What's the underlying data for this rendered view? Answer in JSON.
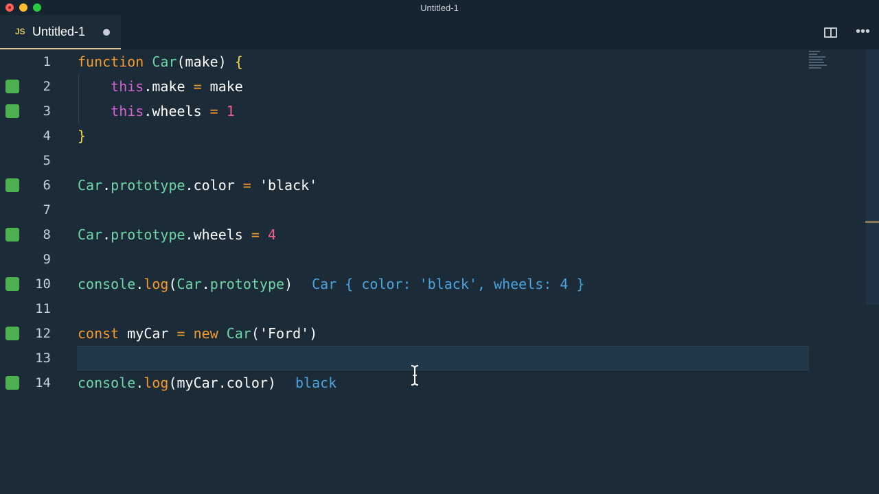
{
  "window": {
    "title": "Untitled-1"
  },
  "tab": {
    "language_badge": "JS",
    "title": "Untitled-1",
    "icons": {
      "dirty": "unsaved-dot-icon",
      "split": "split-editor-icon",
      "more": "more-actions-icon"
    }
  },
  "colors": {
    "background": "#1b2b38",
    "keyword": "#f39a2b",
    "this": "#d463d1",
    "class": "#70d6a8",
    "number": "#f25d8a",
    "result": "#4ca4e0",
    "gutter_added": "#4caf50"
  },
  "editor": {
    "lines": [
      {
        "no": "1",
        "modified": false,
        "tokens": [
          [
            "k-keyword",
            "function"
          ],
          [
            "k-plain",
            " "
          ],
          [
            "k-class",
            "Car"
          ],
          [
            "k-plain",
            "(make) "
          ],
          [
            "k-brace",
            "{"
          ]
        ]
      },
      {
        "no": "2",
        "modified": true,
        "tokens": [
          [
            "k-plain",
            "    "
          ],
          [
            "k-this",
            "this"
          ],
          [
            "k-plain",
            ".make "
          ],
          [
            "k-op",
            "="
          ],
          [
            "k-plain",
            " make"
          ]
        ]
      },
      {
        "no": "3",
        "modified": true,
        "tokens": [
          [
            "k-plain",
            "    "
          ],
          [
            "k-this",
            "this"
          ],
          [
            "k-plain",
            ".wheels "
          ],
          [
            "k-op",
            "="
          ],
          [
            "k-plain",
            " "
          ],
          [
            "k-num",
            "1"
          ]
        ]
      },
      {
        "no": "4",
        "modified": false,
        "tokens": [
          [
            "k-brace",
            "}"
          ]
        ]
      },
      {
        "no": "5",
        "modified": false,
        "tokens": []
      },
      {
        "no": "6",
        "modified": true,
        "tokens": [
          [
            "k-class",
            "Car"
          ],
          [
            "k-plain",
            "."
          ],
          [
            "k-prop",
            "prototype"
          ],
          [
            "k-plain",
            ".color "
          ],
          [
            "k-op",
            "="
          ],
          [
            "k-plain",
            " "
          ],
          [
            "k-str",
            "'black'"
          ]
        ]
      },
      {
        "no": "7",
        "modified": false,
        "tokens": []
      },
      {
        "no": "8",
        "modified": true,
        "tokens": [
          [
            "k-class",
            "Car"
          ],
          [
            "k-plain",
            "."
          ],
          [
            "k-prop",
            "prototype"
          ],
          [
            "k-plain",
            ".wheels "
          ],
          [
            "k-op",
            "="
          ],
          [
            "k-plain",
            " "
          ],
          [
            "k-num",
            "4"
          ]
        ]
      },
      {
        "no": "9",
        "modified": false,
        "tokens": []
      },
      {
        "no": "10",
        "modified": true,
        "tokens": [
          [
            "k-prop",
            "console"
          ],
          [
            "k-plain",
            "."
          ],
          [
            "k-func",
            "log"
          ],
          [
            "k-plain",
            "("
          ],
          [
            "k-class",
            "Car"
          ],
          [
            "k-plain",
            "."
          ],
          [
            "k-prop",
            "prototype"
          ],
          [
            "k-plain",
            ")"
          ]
        ],
        "result": "Car { color: 'black', wheels: 4 }"
      },
      {
        "no": "11",
        "modified": false,
        "tokens": []
      },
      {
        "no": "12",
        "modified": true,
        "tokens": [
          [
            "k-keyword",
            "const"
          ],
          [
            "k-plain",
            " myCar "
          ],
          [
            "k-op",
            "="
          ],
          [
            "k-plain",
            " "
          ],
          [
            "k-keyword",
            "new"
          ],
          [
            "k-plain",
            " "
          ],
          [
            "k-class",
            "Car"
          ],
          [
            "k-plain",
            "("
          ],
          [
            "k-str",
            "'Ford'"
          ],
          [
            "k-plain",
            ")"
          ]
        ]
      },
      {
        "no": "13",
        "modified": false,
        "current": true,
        "tokens": []
      },
      {
        "no": "14",
        "modified": true,
        "tokens": [
          [
            "k-prop",
            "console"
          ],
          [
            "k-plain",
            "."
          ],
          [
            "k-func",
            "log"
          ],
          [
            "k-plain",
            "(myCar.color)"
          ]
        ],
        "result": "black"
      }
    ]
  }
}
